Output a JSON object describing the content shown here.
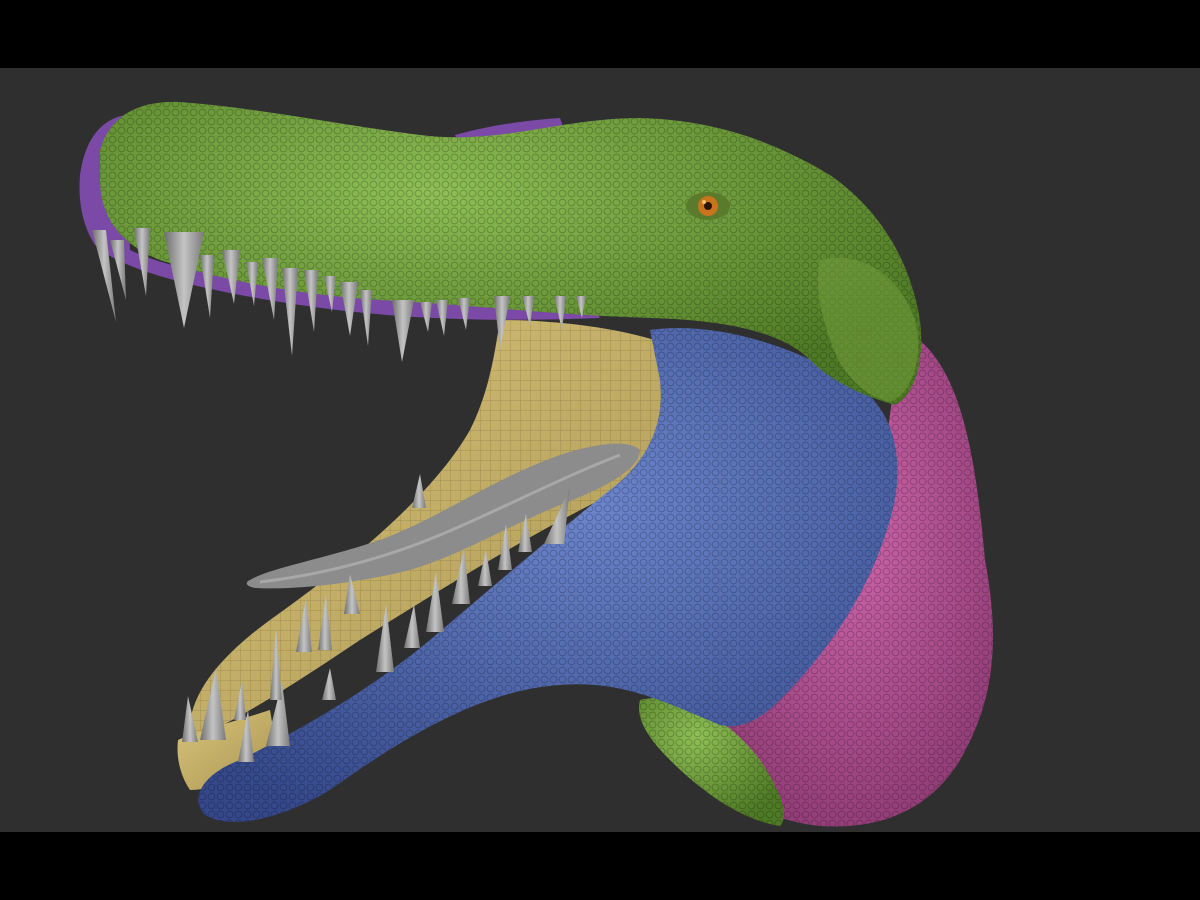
{
  "viewport": {
    "background": "#2f2f2f",
    "letterbox": "#000000",
    "model": {
      "subject": "dinosaur-head-sculpt",
      "polygroup_colors": {
        "upper_snout": "#6f9a3a",
        "gum_lining": "#7a4aa6",
        "mouth_interior": "#c9b56a",
        "lower_jaw": "#4b63a8",
        "neck": "#b54f94",
        "teeth": "#9a9a9a",
        "tongue": "#8c8c8c",
        "eye": "#c8741c"
      }
    }
  }
}
